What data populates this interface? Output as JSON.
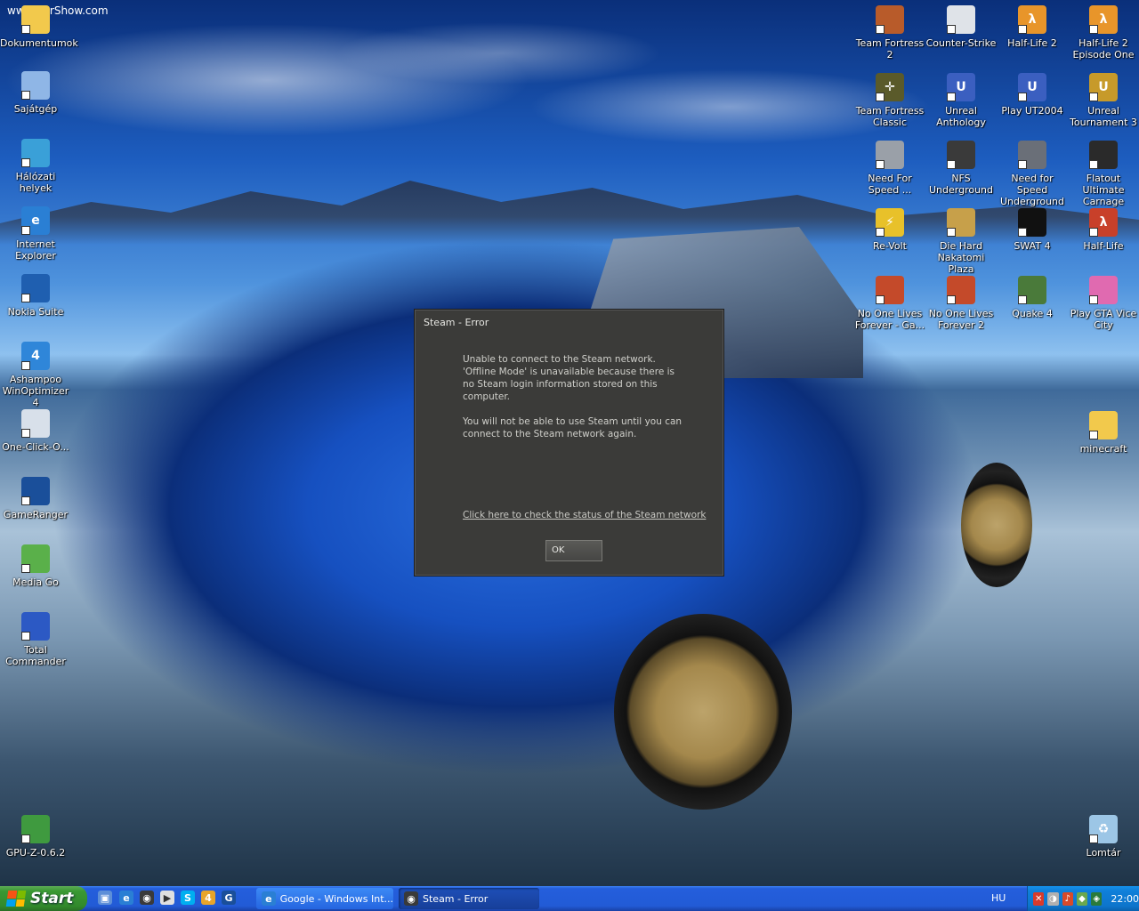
{
  "wallpaper": {
    "watermark": "www.CarShow.com"
  },
  "icons_left": [
    {
      "label": "Dokumentumok",
      "icon": "folder-icon",
      "color": "#f2c94c",
      "glyph": ""
    },
    {
      "label": "Sajátgép",
      "icon": "computer-icon",
      "color": "#8fb6e6",
      "glyph": ""
    },
    {
      "label": "Hálózati helyek",
      "icon": "network-icon",
      "color": "#3aa0d8",
      "glyph": ""
    },
    {
      "label": "Internet Explorer",
      "icon": "internet-explorer-icon",
      "color": "#2a7fd4",
      "glyph": "e"
    },
    {
      "label": "Nokia Suite",
      "icon": "nokia-suite-icon",
      "color": "#1f5fb0",
      "glyph": ""
    },
    {
      "label": "Ashampoo WinOptimizer 4",
      "icon": "ashampoo-icon",
      "color": "#2f86d9",
      "glyph": "4"
    },
    {
      "label": "One-Click-O...",
      "icon": "magic-wand-icon",
      "color": "#d8e0ea",
      "glyph": ""
    },
    {
      "label": "GameRanger",
      "icon": "gameranger-icon",
      "color": "#1a4f9a",
      "glyph": ""
    },
    {
      "label": "Media Go",
      "icon": "media-go-icon",
      "color": "#5ab04a",
      "glyph": ""
    },
    {
      "label": "Total Commander",
      "icon": "floppy-disk-icon",
      "color": "#2c59c4",
      "glyph": ""
    },
    {
      "label": "GPU-Z-0.6.2",
      "icon": "gpu-card-icon",
      "color": "#3f9a3f",
      "glyph": ""
    }
  ],
  "icons_right": [
    {
      "label": "Team Fortress 2",
      "icon": "team-fortress-2-icon",
      "color": "#b85b2a",
      "glyph": ""
    },
    {
      "label": "Counter-Strike",
      "icon": "counter-strike-icon",
      "color": "#dfe3e8",
      "glyph": ""
    },
    {
      "label": "Half-Life 2",
      "icon": "half-life-2-icon",
      "color": "#e8952a",
      "glyph": "λ"
    },
    {
      "label": "Half-Life 2 Episode One",
      "icon": "half-life-2-episode-one-icon",
      "color": "#e8952a",
      "glyph": "λ"
    },
    {
      "label": "Team Fortress Classic",
      "icon": "team-fortress-classic-icon",
      "color": "#5a5a2a",
      "glyph": "✛"
    },
    {
      "label": "Unreal Anthology",
      "icon": "unreal-anthology-icon",
      "color": "#3b5fc0",
      "glyph": "U"
    },
    {
      "label": "Play UT2004",
      "icon": "ut2004-icon",
      "color": "#3b5fc0",
      "glyph": "U"
    },
    {
      "label": "Unreal Tournament 3",
      "icon": "unreal-tournament-3-icon",
      "color": "#c79a2a",
      "glyph": "U"
    },
    {
      "label": "Need For Speed ...",
      "icon": "need-for-speed-icon",
      "color": "#9aa0a8",
      "glyph": ""
    },
    {
      "label": "NFS Underground",
      "icon": "nfs-underground-icon",
      "color": "#3a3a3a",
      "glyph": ""
    },
    {
      "label": "Need for Speed Underground 2",
      "icon": "nfs-underground-2-icon",
      "color": "#6a6f78",
      "glyph": ""
    },
    {
      "label": "Flatout Ultimate Carnage",
      "icon": "flatout-icon",
      "color": "#2a2a2a",
      "glyph": ""
    },
    {
      "label": "Re-Volt",
      "icon": "re-volt-icon",
      "color": "#e8c12a",
      "glyph": "⚡"
    },
    {
      "label": "Die Hard Nakatomi Plaza",
      "icon": "die-hard-icon",
      "color": "#c7a04a",
      "glyph": ""
    },
    {
      "label": "SWAT 4",
      "icon": "swat-4-icon",
      "color": "#111111",
      "glyph": ""
    },
    {
      "label": "Half-Life",
      "icon": "half-life-icon",
      "color": "#c8402a",
      "glyph": "λ"
    },
    {
      "label": "No One Lives Forever - Ga...",
      "icon": "nolf-icon",
      "color": "#c44a2a",
      "glyph": ""
    },
    {
      "label": "No One Lives Forever 2",
      "icon": "nolf-2-icon",
      "color": "#c44a2a",
      "glyph": ""
    },
    {
      "label": "Quake 4",
      "icon": "quake-4-icon",
      "color": "#4a7a3a",
      "glyph": ""
    },
    {
      "label": "Play GTA Vice City",
      "icon": "gta-vice-city-icon",
      "color": "#e06ab0",
      "glyph": ""
    },
    {
      "label": "minecraft",
      "icon": "folder-icon",
      "color": "#f2c94c",
      "glyph": ""
    },
    {
      "label": "Lomtár",
      "icon": "recycle-bin-icon",
      "color": "#9cc6e6",
      "glyph": "♻"
    }
  ],
  "dialog": {
    "title": "Steam - Error",
    "message_1": "Unable to connect to the Steam network. 'Offline Mode' is unavailable because there is no Steam login information stored on this computer.",
    "message_2": "You will not be able to use Steam until you can connect to the Steam network again.",
    "link": "Click here to check the status of the Steam network",
    "ok_label": "OK",
    "bg_color": "#3b3b39"
  },
  "taskbar": {
    "start_label": "Start",
    "tasks": [
      {
        "label": "Google - Windows Int...",
        "icon": "internet-explorer-icon"
      },
      {
        "label": "Steam - Error",
        "icon": "steam-icon"
      }
    ],
    "language": "HU",
    "clock": "22:00"
  }
}
